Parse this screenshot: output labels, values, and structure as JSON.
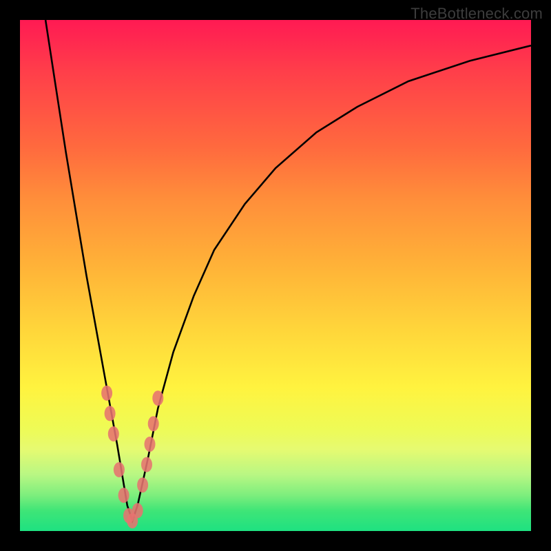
{
  "watermark": "TheBottleneck.com",
  "colors": {
    "background": "#000000",
    "curve": "#000000",
    "scatter": "#e6736f",
    "gradient_top": "#ff1a53",
    "gradient_bottom": "#1ee181"
  },
  "chart_data": {
    "type": "line",
    "title": "",
    "xlabel": "",
    "ylabel": "",
    "xlim": [
      0,
      100
    ],
    "ylim": [
      0,
      100
    ],
    "curve": {
      "name": "bottleneck-curve",
      "description": "V-shaped bottleneck curve; minimum near x≈22",
      "x": [
        5,
        7,
        9,
        11,
        13,
        15,
        17,
        19,
        21,
        22,
        23,
        25,
        27,
        30,
        34,
        38,
        44,
        50,
        58,
        66,
        76,
        88,
        100
      ],
      "y": [
        100,
        87,
        74,
        62,
        50,
        39,
        28,
        17,
        5,
        2,
        5,
        14,
        24,
        35,
        46,
        55,
        64,
        71,
        78,
        83,
        88,
        92,
        95
      ]
    },
    "scatter": {
      "name": "highlight-points",
      "x": [
        17.0,
        17.6,
        18.3,
        19.4,
        20.3,
        21.3,
        22.0,
        23.0,
        24.0,
        24.8,
        25.4,
        26.1,
        27.0
      ],
      "y": [
        27,
        23,
        19,
        12,
        7,
        3,
        2,
        4,
        9,
        13,
        17,
        21,
        26
      ]
    }
  }
}
